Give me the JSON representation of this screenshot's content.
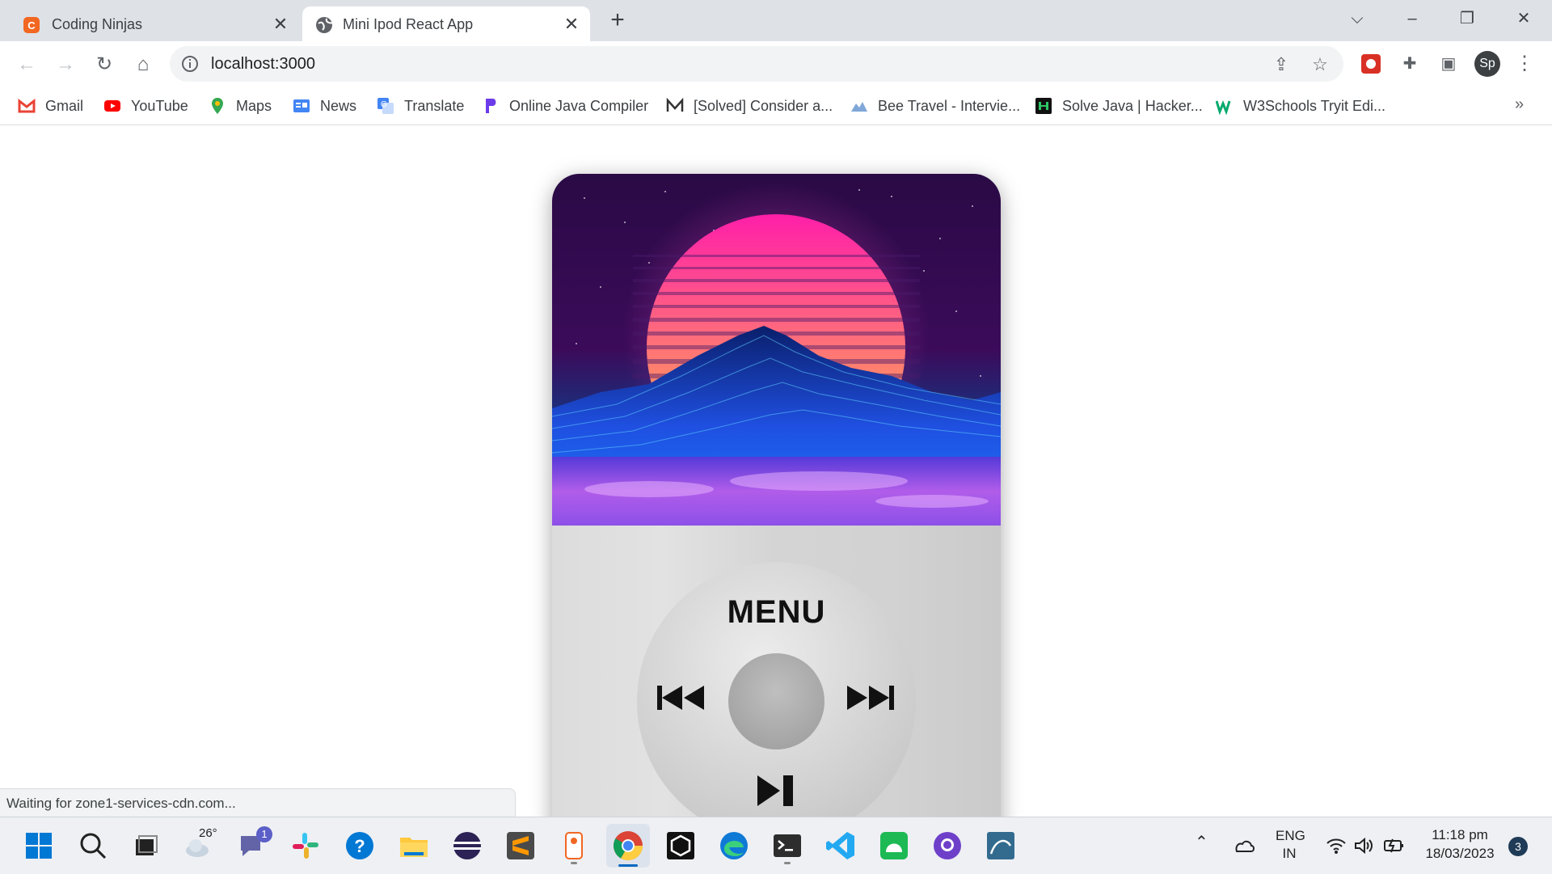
{
  "browser": {
    "tabs": [
      {
        "title": "Coding Ninjas",
        "active": false
      },
      {
        "title": "Mini Ipod React App",
        "active": true
      }
    ],
    "url": "localhost:3000",
    "profile_initials": "Sp",
    "bookmarks": [
      {
        "label": "Gmail",
        "icon": "gmail-icon"
      },
      {
        "label": "YouTube",
        "icon": "youtube-icon"
      },
      {
        "label": "Maps",
        "icon": "maps-icon"
      },
      {
        "label": "News",
        "icon": "news-icon"
      },
      {
        "label": "Translate",
        "icon": "translate-icon"
      },
      {
        "label": "Online Java Compiler",
        "icon": "programiz-icon"
      },
      {
        "label": "[Solved] Consider a...",
        "icon": "medium-icon"
      },
      {
        "label": "Bee Travel - Intervie...",
        "icon": "bee-travel-icon"
      },
      {
        "label": "Solve Java | Hacker...",
        "icon": "hackerrank-icon"
      },
      {
        "label": "W3Schools Tryit Edi...",
        "icon": "w3schools-icon"
      }
    ],
    "status_text": "Waiting for zone1-services-cdn.com..."
  },
  "ipod": {
    "menu_label": "MENU",
    "buttons": [
      "previous-track",
      "next-track",
      "play-pause",
      "select"
    ]
  },
  "taskbar": {
    "weather_temp": "26°",
    "teams_badge": "1",
    "lang_line1": "ENG",
    "lang_line2": "IN",
    "time": "11:18 pm",
    "date": "18/03/2023",
    "notification_count": "3"
  },
  "colors": {
    "tabstrip": "#dee1e6",
    "ipod_body": "#cfcfcf",
    "sun_top": "#ff2fa8",
    "sun_bottom": "#ffb347"
  }
}
